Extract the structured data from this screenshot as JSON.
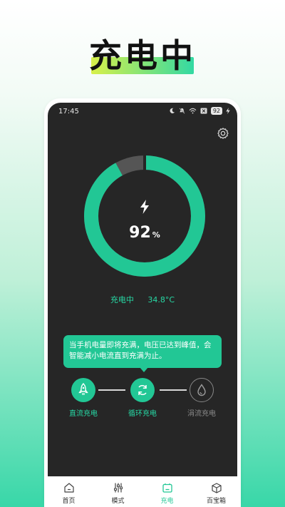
{
  "hero": {
    "title": "充电中"
  },
  "status": {
    "time": "17:45",
    "battery": "92"
  },
  "battery": {
    "percent_value": "92",
    "percent_unit": "%",
    "level": 0.92
  },
  "charge": {
    "state": "充电中",
    "temperature": "34.8°C"
  },
  "tip": {
    "text": "当手机电量即将充满，电压已达到峰值，会智能减小电流直到充满为止。"
  },
  "modes": [
    {
      "label": "直流充电",
      "icon": "rocket-icon",
      "active": true
    },
    {
      "label": "循环充电",
      "icon": "cycle-icon",
      "active": true
    },
    {
      "label": "涓流充电",
      "icon": "drop-icon",
      "active": false
    }
  ],
  "tabs": [
    {
      "label": "首页",
      "icon": "home-icon",
      "active": false
    },
    {
      "label": "模式",
      "icon": "sliders-icon",
      "active": false
    },
    {
      "label": "充电",
      "icon": "battery-icon",
      "active": true
    },
    {
      "label": "百宝箱",
      "icon": "box-icon",
      "active": false
    }
  ],
  "colors": {
    "accent": "#22c795",
    "screen_bg": "#262626",
    "ring_track": "#555555"
  }
}
